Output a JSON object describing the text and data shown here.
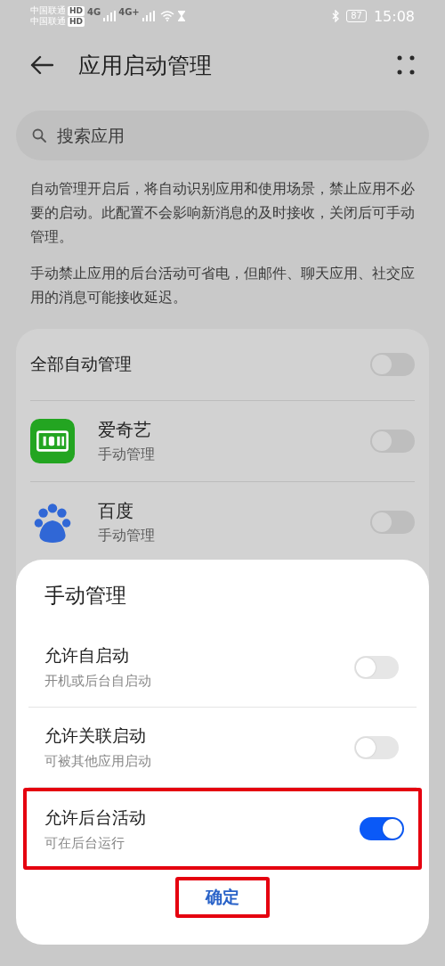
{
  "status_bar": {
    "carriers": [
      {
        "name": "中国联通",
        "badge": "HD"
      },
      {
        "name": "中国联通",
        "badge": "HD"
      }
    ],
    "networks": [
      "4G",
      "4G+"
    ],
    "battery": "87",
    "time": "15:08"
  },
  "header": {
    "title": "应用启动管理"
  },
  "search": {
    "placeholder": "搜索应用"
  },
  "descriptions": [
    "自动管理开启后，将自动识别应用和使用场景，禁止应用不必要的启动。此配置不会影响新消息的及时接收，关闭后可手动管理。",
    "手动禁止应用的后台活动可省电，但邮件、聊天应用、社交应用的消息可能接收延迟。"
  ],
  "master": {
    "label": "全部自动管理",
    "on": false
  },
  "apps": [
    {
      "kind": "video",
      "name": "爱奇艺",
      "mode": "手动管理",
      "on": false
    },
    {
      "kind": "paw",
      "name": "百度",
      "mode": "手动管理",
      "on": false
    }
  ],
  "sheet": {
    "title": "手动管理",
    "options": [
      {
        "label": "允许自启动",
        "hint": "开机或后台自启动",
        "on": false,
        "highlighted": false
      },
      {
        "label": "允许关联启动",
        "hint": "可被其他应用启动",
        "on": false,
        "highlighted": false
      },
      {
        "label": "允许后台活动",
        "hint": "可在后台运行",
        "on": true,
        "highlighted": true
      }
    ],
    "confirm": {
      "label": "确定",
      "highlighted": true
    }
  }
}
